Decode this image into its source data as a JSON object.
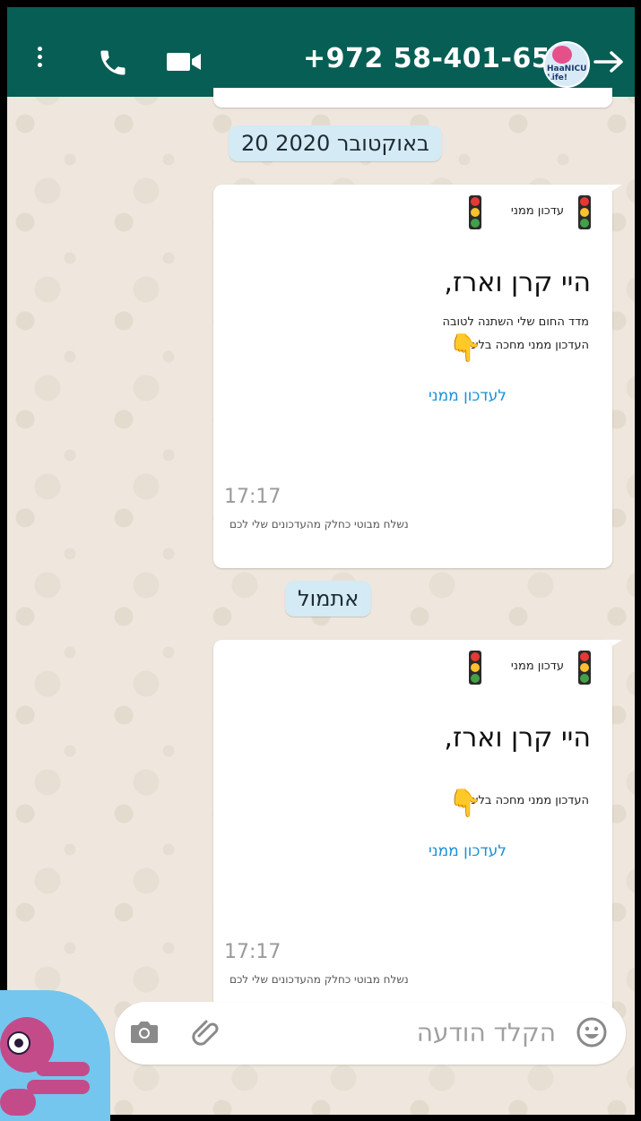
{
  "header": {
    "contact_phone": "+972 58-401-6521",
    "avatar_text": "HaaNICU Life!",
    "icons": [
      "more-vert-icon",
      "call-icon",
      "video-icon",
      "back-arrow-icon"
    ],
    "color": "#075e54"
  },
  "dates": {
    "first": "20 באוקטובר 2020",
    "second": "אתמול"
  },
  "messages": [
    {
      "notice_label": "עדכון ממני",
      "greeting": "היי קרן וארז,",
      "line1": "מדד החום שלי השתנה לטובה",
      "line2": "העדכון ממני מחכה בלינק",
      "link": "לעדכון ממני",
      "time": "17:17",
      "footer": "נשלח מבוטי כחלק מהעדכונים שלי לכם"
    },
    {
      "notice_label": "עדכון ממני",
      "greeting": "היי קרן וארז,",
      "line2": "העדכון ממני מחכה בלינק",
      "link": "לעדכון ממני",
      "time": "17:17",
      "footer": "נשלח מבוטי כחלק מהעדכונים שלי לכם"
    }
  ],
  "input": {
    "placeholder": "הקלד הודעה",
    "icons": [
      "camera-icon",
      "attach-icon",
      "emoji-icon"
    ]
  }
}
